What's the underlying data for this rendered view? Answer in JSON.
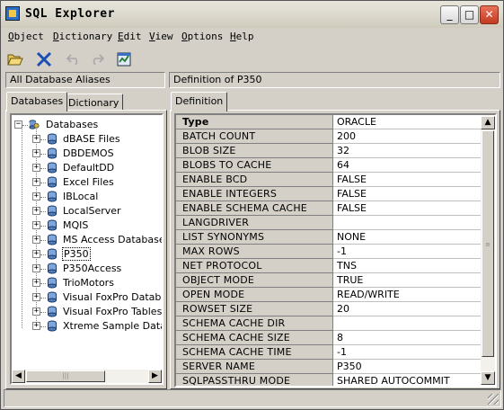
{
  "window": {
    "title": "SQL Explorer",
    "minimize": "_",
    "maximize": "□",
    "close": "✕"
  },
  "menu": [
    "Object",
    "Dictionary",
    "Edit",
    "View",
    "Options",
    "Help"
  ],
  "toolbar": {
    "open_icon": "folder-open-icon",
    "delete_icon": "delete-x-icon",
    "undo_icon": "undo-icon",
    "redo_icon": "redo-icon",
    "apply_icon": "apply-icon"
  },
  "left_header": "All Database Aliases",
  "right_header": "Definition of P350",
  "left_tabs": [
    "Databases",
    "Dictionary"
  ],
  "right_tabs": [
    "Definition"
  ],
  "tree": {
    "root": "Databases",
    "items": [
      {
        "label": "dBASE Files",
        "icon": "database-alias-icon"
      },
      {
        "label": "DBDEMOS",
        "icon": "database-alias-icon"
      },
      {
        "label": "DefaultDD",
        "icon": "database-alias-icon"
      },
      {
        "label": "Excel Files",
        "icon": "database-alias-icon"
      },
      {
        "label": "IBLocal",
        "icon": "database-alias-icon"
      },
      {
        "label": "LocalServer",
        "icon": "database-alias-icon"
      },
      {
        "label": "MQIS",
        "icon": "database-alias-icon"
      },
      {
        "label": "MS Access Database",
        "icon": "database-alias-icon"
      },
      {
        "label": "P350",
        "icon": "database-alias-icon",
        "selected": true
      },
      {
        "label": "P350Access",
        "icon": "database-alias-icon"
      },
      {
        "label": "TrioMotors",
        "icon": "database-alias-icon"
      },
      {
        "label": "Visual FoxPro Database",
        "icon": "database-alias-icon"
      },
      {
        "label": "Visual FoxPro Tables",
        "icon": "database-alias-icon"
      },
      {
        "label": "Xtreme Sample Database",
        "icon": "database-alias-icon"
      }
    ]
  },
  "definition": [
    {
      "name": "Type",
      "value": "ORACLE",
      "bold": true
    },
    {
      "name": "BATCH COUNT",
      "value": "200"
    },
    {
      "name": "BLOB SIZE",
      "value": "32"
    },
    {
      "name": "BLOBS TO CACHE",
      "value": "64"
    },
    {
      "name": "ENABLE BCD",
      "value": "FALSE"
    },
    {
      "name": "ENABLE INTEGERS",
      "value": "FALSE"
    },
    {
      "name": "ENABLE SCHEMA CACHE",
      "value": "FALSE"
    },
    {
      "name": "LANGDRIVER",
      "value": ""
    },
    {
      "name": "LIST SYNONYMS",
      "value": "NONE"
    },
    {
      "name": "MAX ROWS",
      "value": "-1"
    },
    {
      "name": "NET PROTOCOL",
      "value": "TNS"
    },
    {
      "name": "OBJECT MODE",
      "value": "TRUE"
    },
    {
      "name": "OPEN MODE",
      "value": "READ/WRITE"
    },
    {
      "name": "ROWSET SIZE",
      "value": "20"
    },
    {
      "name": "SCHEMA CACHE DIR",
      "value": ""
    },
    {
      "name": "SCHEMA CACHE SIZE",
      "value": "8"
    },
    {
      "name": "SCHEMA CACHE TIME",
      "value": "-1"
    },
    {
      "name": "SERVER NAME",
      "value": "P350"
    },
    {
      "name": "SQLPASSTHRU MODE",
      "value": "SHARED AUTOCOMMIT"
    }
  ],
  "colors": {
    "face": "#d4d0c8",
    "window": "#ffffff",
    "close_button": "#c03a20"
  }
}
